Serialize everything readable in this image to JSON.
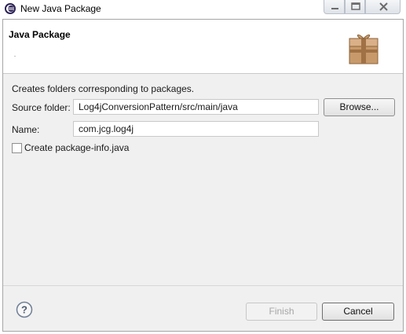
{
  "window": {
    "title": "New Java Package",
    "controls": {
      "minimize_icon": "minimize-icon",
      "maximize_icon": "maximize-icon",
      "close_icon": "close-icon"
    }
  },
  "header": {
    "title": "Java Package",
    "icon": "package-icon"
  },
  "form": {
    "description": "Creates folders corresponding to packages.",
    "source_folder": {
      "label": "Source folder:",
      "value": "Log4jConversionPattern/src/main/java",
      "browse_label": "Browse..."
    },
    "name": {
      "label": "Name:",
      "value": "com.jcg.log4j"
    },
    "package_info": {
      "label": "Create package-info.java",
      "checked": false
    }
  },
  "footer": {
    "help_icon": "help-icon",
    "finish_label": "Finish",
    "finish_enabled": false,
    "cancel_label": "Cancel"
  }
}
